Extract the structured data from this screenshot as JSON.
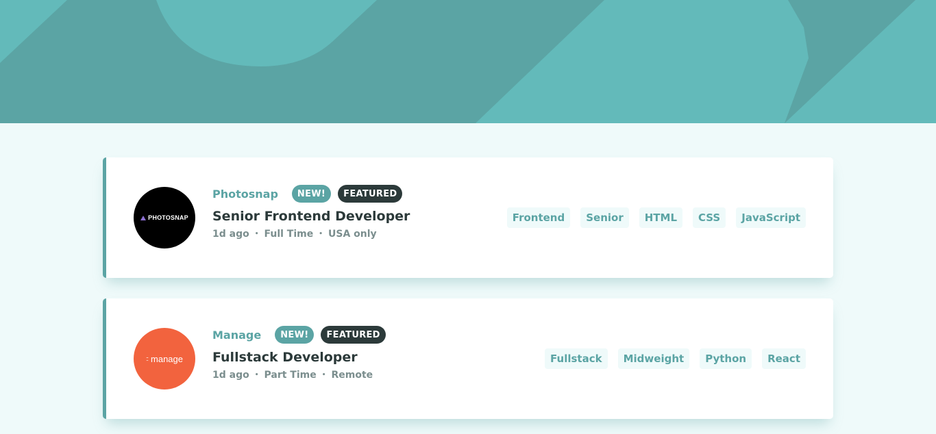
{
  "colors": {
    "primary": "#5ba4a4",
    "background": "#effafa",
    "dark": "#2c3a3a",
    "gray": "#7b8e8e",
    "photosnap_logo_bg": "#000000",
    "manage_logo_bg": "#f2633e"
  },
  "listings": [
    {
      "company": "Photosnap",
      "logo_text": "PHOTOSNAP",
      "new_label": "NEW!",
      "featured_label": "FEATURED",
      "position": "Senior Frontend Developer",
      "posted_at": "1d ago",
      "contract": "Full Time",
      "location": "USA only",
      "tags": [
        "Frontend",
        "Senior",
        "HTML",
        "CSS",
        "JavaScript"
      ]
    },
    {
      "company": "Manage",
      "logo_text": "manage",
      "logo_prefix": "::",
      "new_label": "NEW!",
      "featured_label": "FEATURED",
      "position": "Fullstack Developer",
      "posted_at": "1d ago",
      "contract": "Part Time",
      "location": "Remote",
      "tags": [
        "Fullstack",
        "Midweight",
        "Python",
        "React"
      ]
    }
  ],
  "separator": "•"
}
